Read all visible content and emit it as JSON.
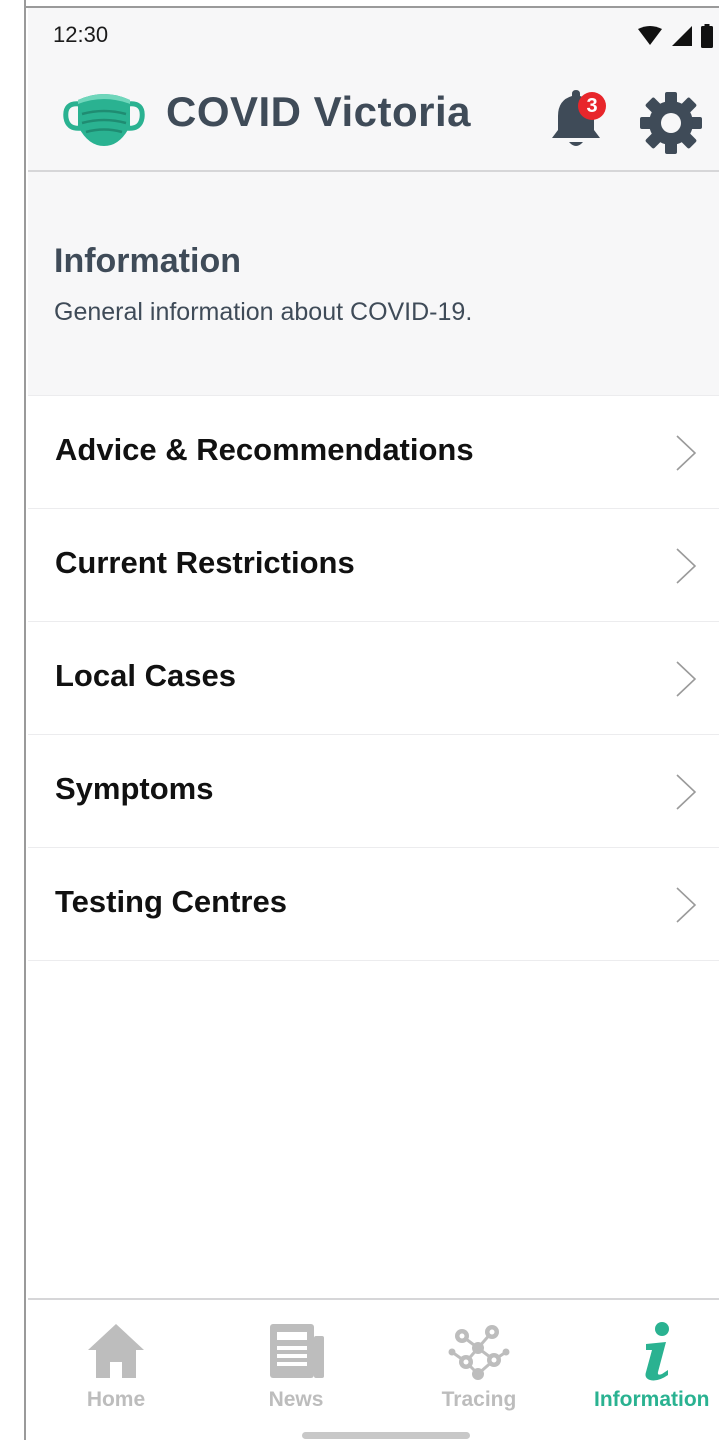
{
  "status_bar": {
    "time": "12:30"
  },
  "header": {
    "title": "COVID Victoria",
    "notification_count": "3",
    "colors": {
      "title": "#3f4b58",
      "logo": "#2ab291",
      "badge": "#e8262b"
    }
  },
  "section": {
    "title": "Information",
    "subtitle": "General information about COVID-19."
  },
  "menu": {
    "items": [
      {
        "label": "Advice & Recommendations"
      },
      {
        "label": "Current Restrictions"
      },
      {
        "label": "Local Cases"
      },
      {
        "label": "Symptoms"
      },
      {
        "label": "Testing Centres"
      }
    ]
  },
  "bottom_nav": {
    "items": [
      {
        "label": "Home",
        "icon": "home-icon",
        "active": false
      },
      {
        "label": "News",
        "icon": "news-icon",
        "active": false
      },
      {
        "label": "Tracing",
        "icon": "tracing-icon",
        "active": false
      },
      {
        "label": "Information",
        "icon": "info-icon",
        "active": true
      }
    ],
    "colors": {
      "active": "#2ab291",
      "inactive": "#bdbdbd"
    }
  }
}
